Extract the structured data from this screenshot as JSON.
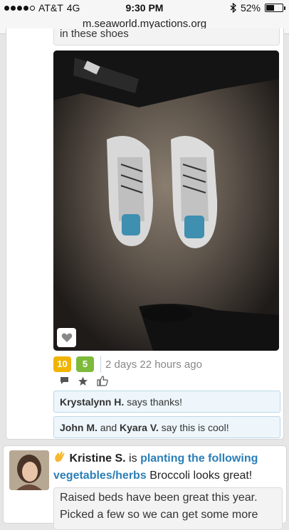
{
  "status_bar": {
    "carrier": "AT&T",
    "network": "4G",
    "time": "9:30 PM",
    "battery": "52%",
    "battery_level": 0.52
  },
  "browser": {
    "url": "m.seaworld.myactions.org"
  },
  "post1": {
    "text_tail": "in these shoes",
    "badge_points": "10",
    "badge_count": "5",
    "timestamp": "2 days 22 hours ago",
    "comment_icon": "comment-icon",
    "star_icon": "star-icon",
    "thumbs_icon": "thumbs-up-icon",
    "reactions": [
      {
        "names": [
          "Krystalynn H."
        ],
        "joiner": "",
        "verb": "says thanks!"
      },
      {
        "names": [
          "John M.",
          "Kyara V."
        ],
        "joiner": "and",
        "verb": "say this is cool!"
      }
    ]
  },
  "post2": {
    "user": "Kristine S.",
    "is": "is",
    "activity": "planting the following vegetables/herbs",
    "summary": "Broccoli looks great!",
    "body": "Raised beds have been great this year. Picked a few so we can get some more"
  },
  "colors": {
    "link": "#2a7fb8",
    "badge_yellow": "#f0b400",
    "badge_green": "#7dba3c",
    "comment_bg": "#eef6fb"
  }
}
